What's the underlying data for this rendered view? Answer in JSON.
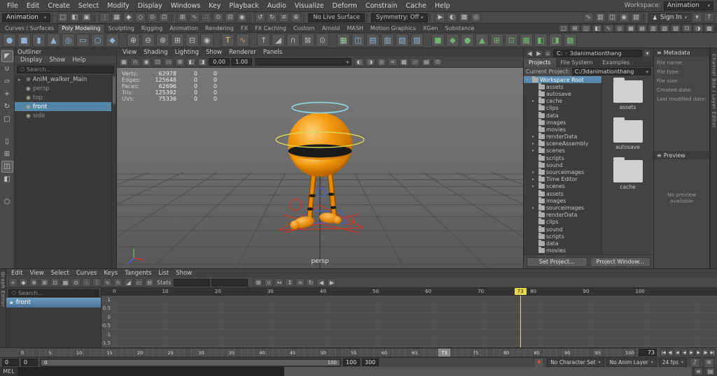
{
  "colors": {
    "selection_blue": "#5285a6",
    "playhead_yellow": "#e8d84a",
    "character_orange": "#f0930c",
    "halo_cyan": "#8fd4de",
    "control_yellow": "#d8d855",
    "control_red": "#c83a28",
    "control_blue": "#4a62c8"
  },
  "menubar": {
    "items": [
      "File",
      "Edit",
      "Create",
      "Select",
      "Modify",
      "Display",
      "Windows",
      "Key",
      "Playback",
      "Audio",
      "Visualize",
      "Deform",
      "Constrain",
      "Cache",
      "Help"
    ],
    "workspace_label": "Workspace:",
    "workspace_value": "Animation"
  },
  "statusline": {
    "mode": "Animation",
    "file_icons": [
      {
        "name": "new-scene-icon",
        "glyph": "□"
      },
      {
        "name": "open-scene-icon",
        "glyph": "◧"
      },
      {
        "name": "save-scene-icon",
        "glyph": "▣"
      }
    ],
    "selection_icons": [
      {
        "name": "select-hierarchy-icon",
        "glyph": "⋮"
      },
      {
        "name": "select-object-icon",
        "glyph": "▦"
      },
      {
        "name": "select-component-icon",
        "glyph": "◆"
      },
      {
        "name": "select-mask-icon",
        "glyph": "◇"
      },
      {
        "name": "highlight-selection-icon",
        "glyph": "⊙"
      },
      {
        "name": "rubberband-select-icon",
        "glyph": "⊡"
      }
    ],
    "snap_icons": [
      {
        "name": "snap-grid-icon",
        "glyph": "⊞"
      },
      {
        "name": "snap-curve-icon",
        "glyph": "∿"
      },
      {
        "name": "snap-point-icon",
        "glyph": "∴"
      },
      {
        "name": "snap-projected-center-icon",
        "glyph": "⊙"
      },
      {
        "name": "snap-view-plane-icon",
        "glyph": "⊟"
      },
      {
        "name": "make-live-icon",
        "glyph": "◉"
      }
    ],
    "history_icons": [
      {
        "name": "input-operations-icon",
        "glyph": "↺"
      },
      {
        "name": "output-operations-icon",
        "glyph": "↻"
      },
      {
        "name": "construction-history-icon",
        "glyph": "≡"
      },
      {
        "name": "select-by-input-icon",
        "glyph": "⊕"
      }
    ],
    "live_surface": "No Live Surface",
    "symmetry": "Symmetry: Off",
    "render_icons": [
      {
        "name": "render-current-frame-icon",
        "glyph": "▶"
      },
      {
        "name": "ipr-render-icon",
        "glyph": "◐"
      },
      {
        "name": "render-settings-icon",
        "glyph": "▩"
      },
      {
        "name": "hypershade-icon",
        "glyph": "◎"
      }
    ],
    "extra_icons": [
      {
        "name": "paint-effects-icon",
        "glyph": "∿"
      },
      {
        "name": "toolbox-extra-icon",
        "glyph": "▥"
      },
      {
        "name": "viewport-toggle-icon",
        "glyph": "◫"
      },
      {
        "name": "light-toggle-icon",
        "glyph": "◉"
      },
      {
        "name": "texture-toggle-icon",
        "glyph": "▨"
      }
    ],
    "sign_in": "Sign In",
    "right_icons": [
      {
        "name": "caret-down-icon",
        "glyph": "▾"
      },
      {
        "name": "help-icon",
        "glyph": "?"
      }
    ]
  },
  "shelf": {
    "tabs": [
      {
        "label": "Curves / Surfaces"
      },
      {
        "label": "Poly Modeling",
        "active": true
      },
      {
        "label": "Sculpting"
      },
      {
        "label": "Rigging"
      },
      {
        "label": "Animation"
      },
      {
        "label": "Rendering"
      },
      {
        "label": "FX"
      },
      {
        "label": "FX Caching"
      },
      {
        "label": "Custom"
      },
      {
        "label": "Arnold"
      },
      {
        "label": "MASH"
      },
      {
        "label": "Motion Graphics"
      },
      {
        "label": "XGen"
      },
      {
        "label": "Substance"
      }
    ],
    "tabs_row_icons": [
      {
        "name": "pane-layout-single-icon",
        "glyph": "□"
      },
      {
        "name": "pane-layout-four-icon",
        "glyph": "⊞"
      },
      {
        "name": "pane-layout-split-icon",
        "glyph": "◫"
      },
      {
        "name": "pane-outliner-icon",
        "glyph": "◧"
      },
      {
        "name": "pane-graph-icon",
        "glyph": "∿"
      },
      {
        "name": "pane-hypershade-icon",
        "glyph": "◎"
      },
      {
        "name": "pane-uv-icon",
        "glyph": "▦"
      },
      {
        "name": "pane-persp-icon",
        "glyph": "▤"
      },
      {
        "name": "pane-top-icon",
        "glyph": "▥"
      },
      {
        "name": "pane-front-icon",
        "glyph": "▧"
      },
      {
        "name": "pane-side-icon",
        "glyph": "▨"
      },
      {
        "name": "pane-custom-icon",
        "glyph": "⊡"
      },
      {
        "name": "pane-anim-icon",
        "glyph": "◑"
      },
      {
        "name": "pane-render-icon",
        "glyph": "▩"
      }
    ],
    "icons": [
      {
        "name": "poly-sphere-icon",
        "glyph": "●",
        "color": "#8fb2d4"
      },
      {
        "name": "poly-cube-icon",
        "glyph": "■",
        "color": "#8fb2d4"
      },
      {
        "name": "poly-cylinder-icon",
        "glyph": "▮",
        "color": "#8fb2d4"
      },
      {
        "name": "poly-cone-icon",
        "glyph": "▲",
        "color": "#8fb2d4"
      },
      {
        "name": "poly-torus-icon",
        "glyph": "◎",
        "color": "#8fb2d4"
      },
      {
        "name": "poly-plane-icon",
        "glyph": "▭",
        "color": "#8fb2d4"
      },
      {
        "name": "poly-disc-icon",
        "glyph": "○",
        "color": "#8fb2d4"
      },
      {
        "name": "platonic-solid-icon",
        "glyph": "◆",
        "color": "#8fb2d4"
      },
      {
        "name": "shelf-separator",
        "sep": true
      },
      {
        "name": "boolean-union-icon",
        "glyph": "⊕",
        "color": "#c0c0c0"
      },
      {
        "name": "boolean-difference-icon",
        "glyph": "⊖",
        "color": "#c0c0c0"
      },
      {
        "name": "boolean-intersect-icon",
        "glyph": "⊗",
        "color": "#c0c0c0"
      },
      {
        "name": "combine-icon",
        "glyph": "⊞",
        "color": "#c0c0c0"
      },
      {
        "name": "separate-icon",
        "glyph": "⊟",
        "color": "#c0c0c0"
      },
      {
        "name": "smooth-icon",
        "glyph": "◉",
        "color": "#c0c0c0"
      },
      {
        "name": "shelf-separator",
        "sep": true
      },
      {
        "name": "poly-text-icon",
        "glyph": "T",
        "color": "#e8c87a"
      },
      {
        "name": "sweep-mesh-icon",
        "glyph": "∿",
        "color": "#d09a6a"
      },
      {
        "name": "shelf-separator",
        "sep": true
      },
      {
        "name": "extrude-icon",
        "glyph": "↑",
        "color": "#b8b8b8"
      },
      {
        "name": "bevel-icon",
        "glyph": "◢",
        "color": "#b8b8b8"
      },
      {
        "name": "bridge-icon",
        "glyph": "∩",
        "color": "#b8b8b8"
      },
      {
        "name": "multi-cut-icon",
        "glyph": "⊠",
        "color": "#b8b8b8"
      },
      {
        "name": "target-weld-icon",
        "glyph": "⊙",
        "color": "#b8b8b8"
      },
      {
        "name": "shelf-separator",
        "sep": true
      },
      {
        "name": "quad-draw-icon",
        "glyph": "▦",
        "color": "#9fc9a0"
      },
      {
        "name": "mirror-icon",
        "glyph": "◫",
        "color": "#8fb2d4"
      },
      {
        "name": "lattice-icon",
        "glyph": "▤",
        "color": "#8fb2d4"
      },
      {
        "name": "wrap-icon",
        "glyph": "▥",
        "color": "#8fb2d4"
      },
      {
        "name": "sculpt-icon",
        "glyph": "▧",
        "color": "#8fb2d4"
      },
      {
        "name": "relax-icon",
        "glyph": "▨",
        "color": "#8fb2d4"
      },
      {
        "name": "shelf-separator",
        "sep": true
      },
      {
        "name": "custom-green-tool-1-icon",
        "glyph": "■",
        "color": "#74b274"
      },
      {
        "name": "custom-green-tool-2-icon",
        "glyph": "◆",
        "color": "#74b274"
      },
      {
        "name": "custom-green-tool-3-icon",
        "glyph": "●",
        "color": "#74b274"
      },
      {
        "name": "custom-green-tool-4-icon",
        "glyph": "▲",
        "color": "#74b274"
      },
      {
        "name": "custom-green-tool-5-icon",
        "glyph": "⊞",
        "color": "#74b274"
      },
      {
        "name": "custom-green-tool-6-icon",
        "glyph": "⊡",
        "color": "#74b274"
      },
      {
        "name": "custom-green-tool-7-icon",
        "glyph": "▦",
        "color": "#74b274"
      },
      {
        "name": "custom-green-tool-8-icon",
        "glyph": "◧",
        "color": "#74b274"
      },
      {
        "name": "custom-green-tool-9-icon",
        "glyph": "◨",
        "color": "#74b274"
      },
      {
        "name": "custom-green-tool-10-icon",
        "glyph": "▩",
        "color": "#74b274"
      }
    ]
  },
  "toolbox": {
    "tools": [
      {
        "name": "select-tool",
        "glyph": "◤",
        "active": true
      },
      {
        "name": "lasso-tool",
        "glyph": "∪"
      },
      {
        "name": "paint-select-tool",
        "glyph": "▱"
      },
      {
        "name": "move-tool",
        "glyph": "+"
      },
      {
        "name": "rotate-tool",
        "glyph": "↻"
      },
      {
        "name": "scale-tool",
        "glyph": "□"
      }
    ],
    "layouts": [
      {
        "name": "layout-single-pane-button",
        "glyph": "▯"
      },
      {
        "name": "layout-four-pane-button",
        "glyph": "⊞"
      },
      {
        "name": "layout-split-pane-button",
        "glyph": "◫",
        "active": true
      },
      {
        "name": "layout-outliner-persp-button",
        "glyph": "◧"
      }
    ]
  },
  "outliner": {
    "title": "Outliner",
    "menus": [
      "Display",
      "Show",
      "Help"
    ],
    "search_placeholder": "Search...",
    "items": [
      {
        "label": "AniM_walker_Main",
        "twisty": "▸",
        "glyph": "⊕"
      },
      {
        "label": "persp",
        "twisty": "",
        "glyph": "◉",
        "dim": true
      },
      {
        "label": "top",
        "twisty": "",
        "glyph": "◉",
        "dim": true
      },
      {
        "label": "front",
        "twisty": "",
        "glyph": "◉",
        "selected": true
      },
      {
        "label": "side",
        "twisty": "",
        "glyph": "◉",
        "dim": true
      }
    ]
  },
  "viewport": {
    "menus": [
      "View",
      "Shading",
      "Lighting",
      "Show",
      "Renderer",
      "Panels"
    ],
    "toolbar_left": [
      {
        "name": "select-camera-icon",
        "glyph": "▦"
      },
      {
        "name": "lock-camera-icon",
        "glyph": "∩"
      },
      {
        "name": "camera-attributes-icon",
        "glyph": "◉"
      },
      {
        "name": "bookmark-icon",
        "glyph": "⊡"
      },
      {
        "name": "image-plane-icon",
        "glyph": "▭"
      },
      {
        "name": "2d-pan-zoom-icon",
        "glyph": "⊞"
      },
      {
        "name": "oversize-gate-icon",
        "glyph": "◧"
      },
      {
        "name": "gate-mask-icon",
        "glyph": "◨"
      }
    ],
    "exposure": "0.00",
    "gamma": "1.00",
    "toolbar_right": [
      {
        "name": "lights-icon",
        "glyph": "◐"
      },
      {
        "name": "shadows-icon",
        "glyph": "◑"
      },
      {
        "name": "ambient-occlusion-icon",
        "glyph": "◎"
      },
      {
        "name": "motion-blur-icon",
        "glyph": "≈"
      },
      {
        "name": "multisample-icon",
        "glyph": "▩"
      },
      {
        "name": "xray-icon",
        "glyph": "▱"
      },
      {
        "name": "wireframe-on-shaded-icon",
        "glyph": "▤"
      },
      {
        "name": "isolate-select-icon",
        "glyph": "⊙"
      }
    ],
    "hud": [
      {
        "label": "Verts:",
        "value": "62978",
        "a": "0",
        "b": "0"
      },
      {
        "label": "Edges:",
        "value": "125648",
        "a": "0",
        "b": "0"
      },
      {
        "label": "Faces:",
        "value": "62696",
        "a": "0",
        "b": "0"
      },
      {
        "label": "Tris:",
        "value": "125392",
        "a": "0",
        "b": "0"
      },
      {
        "label": "UVs:",
        "value": "75336",
        "a": "0",
        "b": "0"
      }
    ],
    "persp_label": "persp"
  },
  "cbrowser": {
    "path_drive": "C:",
    "path_sep": "›",
    "path_name": "3danimationthang",
    "tabs": [
      {
        "label": "Projects",
        "active": true
      },
      {
        "label": "File System"
      },
      {
        "label": "Examples"
      }
    ],
    "current_label": "Current Project:",
    "current_value": "C:/3danimationthang",
    "tree": [
      {
        "label": "Workspace Root",
        "arrow": "▾",
        "indent": 0,
        "selected": true
      },
      {
        "label": "assets",
        "arrow": "",
        "indent": 1
      },
      {
        "label": "autosave",
        "arrow": "",
        "indent": 1
      },
      {
        "label": "cache",
        "arrow": "▸",
        "indent": 1
      },
      {
        "label": "clips",
        "arrow": "",
        "indent": 1
      },
      {
        "label": "data",
        "arrow": "",
        "indent": 1
      },
      {
        "label": "images",
        "arrow": "",
        "indent": 1
      },
      {
        "label": "movies",
        "arrow": "",
        "indent": 1
      },
      {
        "label": "renderData",
        "arrow": "▸",
        "indent": 1
      },
      {
        "label": "sceneAssembly",
        "arrow": "▸",
        "indent": 1
      },
      {
        "label": "scenes",
        "arrow": "▸",
        "indent": 1
      },
      {
        "label": "scripts",
        "arrow": "",
        "indent": 1
      },
      {
        "label": "sound",
        "arrow": "",
        "indent": 1
      },
      {
        "label": "sourceimages",
        "arrow": "▸",
        "indent": 1
      },
      {
        "label": "Time Editor",
        "arrow": "▸",
        "indent": 1
      },
      {
        "label": "scenes",
        "arrow": "▸",
        "indent": 1
      },
      {
        "label": "assets",
        "arrow": "",
        "indent": 1
      },
      {
        "label": "images",
        "arrow": "",
        "indent": 1
      },
      {
        "label": "sourceimages",
        "arrow": "▸",
        "indent": 1
      },
      {
        "label": "renderData",
        "arrow": "",
        "indent": 1
      },
      {
        "label": "clips",
        "arrow": "",
        "indent": 1
      },
      {
        "label": "sound",
        "arrow": "",
        "indent": 1
      },
      {
        "label": "scripts",
        "arrow": "",
        "indent": 1
      },
      {
        "label": "data",
        "arrow": "",
        "indent": 1
      },
      {
        "label": "movies",
        "arrow": "",
        "indent": 1
      }
    ],
    "folders": [
      {
        "label": "assets"
      },
      {
        "label": "autosave"
      },
      {
        "label": "cache"
      }
    ],
    "set_project": "Set Project...",
    "project_window": "Project Window..."
  },
  "metadata": {
    "title": "Metadata",
    "fields": [
      "File name:",
      "File type:",
      "File size:",
      "Created date:",
      "Last modified date:"
    ],
    "preview_title": "Preview",
    "preview_empty": "No preview available"
  },
  "rightstrip": {
    "label": "Channel Box / Layer Editor"
  },
  "graph": {
    "side_label": "Graph Editor",
    "menus": [
      "Edit",
      "View",
      "Select",
      "Curves",
      "Keys",
      "Tangents",
      "List",
      "Show"
    ],
    "toolbar_left": [
      {
        "name": "move-keys-icon",
        "glyph": "+"
      },
      {
        "name": "insert-keys-icon",
        "glyph": "◆"
      },
      {
        "name": "add-keys-icon",
        "glyph": "⊕"
      },
      {
        "name": "lattice-deform-keys-icon",
        "glyph": "⊞"
      },
      {
        "name": "frame-all-icon",
        "glyph": "⊡"
      },
      {
        "name": "frame-playback-icon",
        "glyph": "▦"
      },
      {
        "name": "center-current-time-icon",
        "glyph": "⊙"
      },
      {
        "name": "snap-time-icon",
        "glyph": "∴"
      },
      {
        "name": "snap-value-icon",
        "glyph": "⋮"
      },
      {
        "name": "spline-tangent-icon",
        "glyph": "∿"
      },
      {
        "name": "clamped-tangent-icon",
        "glyph": "∩"
      },
      {
        "name": "linear-tangent-icon",
        "glyph": "◢"
      },
      {
        "name": "flat-tangent-icon",
        "glyph": "▭"
      },
      {
        "name": "step-tangent-icon",
        "glyph": "⊟"
      }
    ],
    "stats_label": "Stats",
    "toolbar_right": [
      {
        "name": "break-tangents-icon",
        "glyph": "⊠"
      },
      {
        "name": "unify-tangents-icon",
        "glyph": "∪"
      },
      {
        "name": "free-tangent-icon",
        "glyph": "↔"
      },
      {
        "name": "lock-tangent-icon",
        "glyph": "↕"
      },
      {
        "name": "buffer-curve-icon",
        "glyph": "≈"
      },
      {
        "name": "swap-buffer-icon",
        "glyph": "↻"
      },
      {
        "name": "pre-infinity-icon",
        "glyph": "◀"
      },
      {
        "name": "post-infinity-icon",
        "glyph": "▶"
      }
    ],
    "search_placeholder": "Search...",
    "item_label": "front",
    "yticks": [
      "1",
      "0.5",
      "0",
      "-0.5",
      "-1",
      "-1.5"
    ],
    "ruler": [
      "0",
      "10",
      "20",
      "30",
      "40",
      "50",
      "60",
      "70",
      "80",
      "90",
      "100"
    ],
    "playhead_label": "73"
  },
  "timeline": {
    "numbers": [
      "0",
      "5",
      "10",
      "15",
      "20",
      "25",
      "30",
      "35",
      "40",
      "45",
      "50",
      "55",
      "60",
      "65",
      "70",
      "75",
      "80",
      "85",
      "90",
      "95",
      "100"
    ],
    "current": "73",
    "frame_field": "73",
    "playback": [
      {
        "name": "go-to-start-button",
        "glyph": "|◀"
      },
      {
        "name": "step-back-frame-button",
        "glyph": "◀|"
      },
      {
        "name": "step-back-key-button",
        "glyph": "◀"
      },
      {
        "name": "play-backwards-button",
        "glyph": "◀"
      },
      {
        "name": "play-forwards-button",
        "glyph": "▶"
      },
      {
        "name": "step-forward-key-button",
        "glyph": "▶"
      },
      {
        "name": "step-forward-frame-button",
        "glyph": "|▶"
      },
      {
        "name": "go-to-end-button",
        "glyph": "▶|"
      }
    ]
  },
  "range": {
    "anim_start": "0",
    "play_start": "0",
    "inner_left": "0",
    "inner_right": "100",
    "play_end": "100",
    "anim_end": "300",
    "char_set": "No Character Set",
    "anim_layer": "No Anim Layer",
    "fps": "24 fps"
  },
  "cmd": {
    "label": "MEL"
  }
}
